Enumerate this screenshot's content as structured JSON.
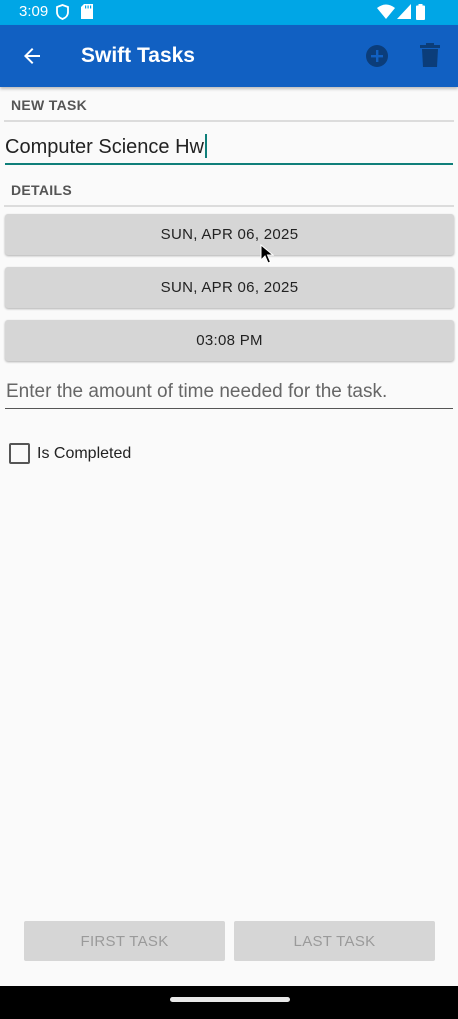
{
  "status_bar": {
    "time": "3:09",
    "icons": [
      "shield-icon",
      "sd-card-icon",
      "wifi-icon",
      "signal-icon",
      "battery-icon"
    ]
  },
  "app_bar": {
    "title": "Swift Tasks",
    "icons": [
      "back-arrow-icon",
      "add-circle-icon",
      "trash-icon"
    ],
    "color": "#1160c2"
  },
  "form": {
    "new_task_label": "NEW TASK",
    "task_name_value": "Computer Science Hw",
    "details_label": "DETAILS",
    "start_date_button": "SUN, APR 06, 2025",
    "end_date_button": "SUN, APR 06, 2025",
    "time_button": "03:08 PM",
    "time_needed_placeholder": "Enter the amount of time needed for the task.",
    "is_completed_label": "Is Completed",
    "is_completed_checked": false
  },
  "footer": {
    "first_task_button": "FIRST TASK",
    "last_task_button": "LAST TASK"
  },
  "colors": {
    "status_bar": "#00a6e6",
    "accent": "#0f7f7a"
  }
}
